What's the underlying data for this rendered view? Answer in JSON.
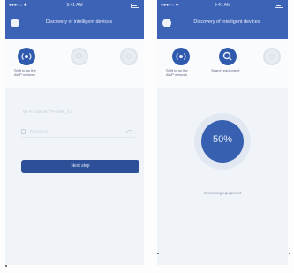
{
  "left_screen": {
    "status": {
      "carrier": "●●●○○ ✱",
      "time": "9:41 AM"
    },
    "header": {
      "title": "Discovery of intelligent devices"
    },
    "steps": [
      {
        "label": "Shift to go the\nAWP network",
        "state": "active",
        "icon": "wifi-icon"
      },
      {
        "label": "",
        "state": "inactive",
        "icon": "search-icon"
      },
      {
        "label": "",
        "state": "inactive",
        "icon": "check-icon"
      }
    ],
    "form": {
      "ssid_text": "Wi-Fi network: TP-LINK_2.4",
      "password_placeholder": "Password",
      "submit_label": "Next step"
    }
  },
  "right_screen": {
    "status": {
      "carrier": "●●●○○ ✱",
      "time": "9:41 AM"
    },
    "header": {
      "title": "Discovery of intelligent devices"
    },
    "steps": [
      {
        "label": "Shift to go the\nAWP network",
        "state": "active",
        "icon": "wifi-icon"
      },
      {
        "label": "Search equipment",
        "state": "active",
        "icon": "search-icon"
      },
      {
        "label": "",
        "state": "inactive",
        "icon": "check-icon"
      }
    ],
    "progress": {
      "percent": 50,
      "label": "50%",
      "status": "Searching equipment"
    }
  },
  "colors": {
    "primary": "#3d63b6",
    "button": "#2c4f98",
    "progress": "#3760b0",
    "background": "#f0f3f8"
  }
}
